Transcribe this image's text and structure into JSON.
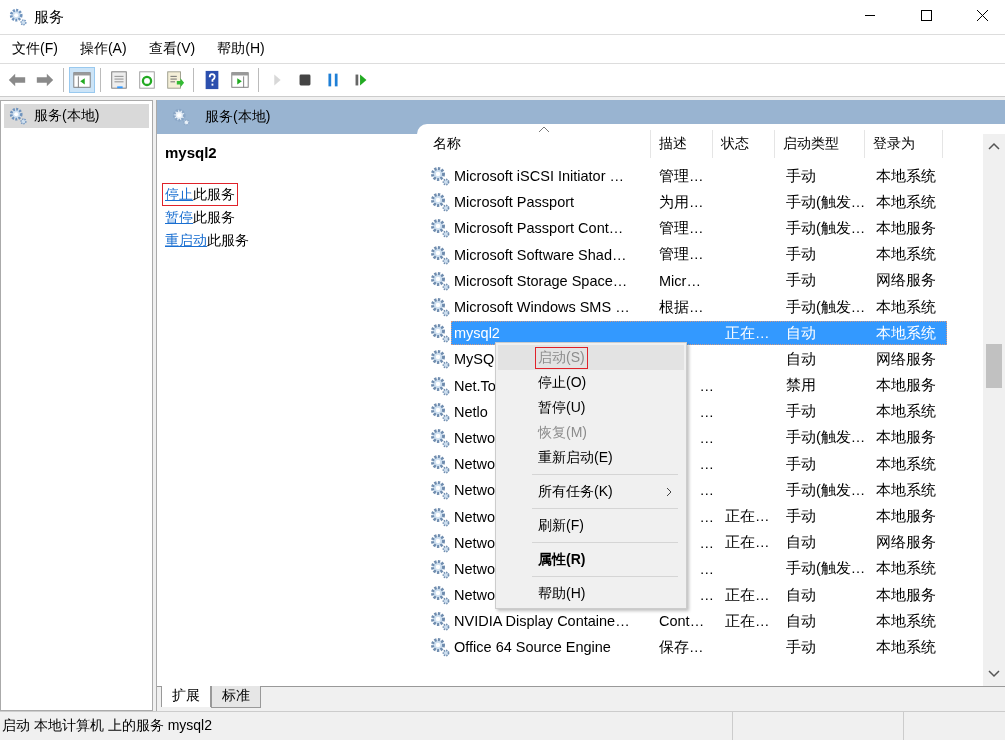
{
  "window": {
    "title": "服务"
  },
  "menu_bar": [
    "文件(F)",
    "操作(A)",
    "查看(V)",
    "帮助(H)"
  ],
  "toolbar": [
    {
      "kind": "back",
      "selected": false,
      "disabled": false
    },
    {
      "kind": "forward",
      "selected": false,
      "disabled": false
    },
    {
      "kind": "separator"
    },
    {
      "kind": "tree",
      "selected": true,
      "disabled": false
    },
    {
      "kind": "separator"
    },
    {
      "kind": "properties",
      "selected": false,
      "disabled": false
    },
    {
      "kind": "refresh",
      "selected": false,
      "disabled": false
    },
    {
      "kind": "export",
      "selected": false,
      "disabled": false
    },
    {
      "kind": "separator"
    },
    {
      "kind": "help",
      "selected": false,
      "disabled": false
    },
    {
      "kind": "actionpane",
      "selected": false,
      "disabled": false
    },
    {
      "kind": "separator"
    },
    {
      "kind": "play",
      "selected": false,
      "disabled": true
    },
    {
      "kind": "stop",
      "selected": false,
      "disabled": false
    },
    {
      "kind": "pause",
      "selected": false,
      "disabled": false
    },
    {
      "kind": "resume",
      "selected": false,
      "disabled": false
    }
  ],
  "tree": [
    {
      "label": "服务(本地)",
      "selected": true
    }
  ],
  "panel": {
    "title": "服务(本地)",
    "service_name": "mysql2",
    "actions": [
      {
        "link": "停止",
        "text": "此服务",
        "annotated": true
      },
      {
        "link": "暂停",
        "text": "此服务",
        "annotated": false
      },
      {
        "link": "重启动",
        "text": "此服务",
        "annotated": false
      }
    ]
  },
  "table": {
    "columns": [
      {
        "label": "名称",
        "sorted": true
      },
      {
        "label": "描述",
        "sorted": false
      },
      {
        "label": "状态",
        "sorted": false
      },
      {
        "label": "启动类型",
        "sorted": false
      },
      {
        "label": "登录为",
        "sorted": false
      }
    ],
    "rows": [
      {
        "name": "Microsoft iSCSI Initiator …",
        "desc": "管理…",
        "status": "",
        "startup": "手动",
        "logon": "本地系统",
        "selected": false
      },
      {
        "name": "Microsoft Passport",
        "desc": "为用…",
        "status": "",
        "startup": "手动(触发…",
        "logon": "本地系统",
        "selected": false
      },
      {
        "name": "Microsoft Passport Cont…",
        "desc": "管理…",
        "status": "",
        "startup": "手动(触发…",
        "logon": "本地服务",
        "selected": false
      },
      {
        "name": "Microsoft Software Shad…",
        "desc": "管理…",
        "status": "",
        "startup": "手动",
        "logon": "本地系统",
        "selected": false
      },
      {
        "name": "Microsoft Storage Space…",
        "desc": "Micr…",
        "status": "",
        "startup": "手动",
        "logon": "网络服务",
        "selected": false
      },
      {
        "name": "Microsoft Windows SMS …",
        "desc": "根据…",
        "status": "",
        "startup": "手动(触发…",
        "logon": "本地系统",
        "selected": false
      },
      {
        "name": "mysql2",
        "desc": "",
        "status": "正在…",
        "startup": "自动",
        "logon": "本地系统",
        "selected": true
      },
      {
        "name": "MySQ",
        "desc": "",
        "status": "",
        "startup": "自动",
        "logon": "网络服务",
        "selected": false
      },
      {
        "name": "Net.To",
        "desc": "…",
        "status": "",
        "startup": "禁用",
        "logon": "本地服务",
        "selected": false
      },
      {
        "name": "Netlo",
        "desc": "…",
        "status": "",
        "startup": "手动",
        "logon": "本地系统",
        "selected": false
      },
      {
        "name": "Netwo",
        "desc": "…",
        "status": "",
        "startup": "手动(触发…",
        "logon": "本地服务",
        "selected": false
      },
      {
        "name": "Netwo",
        "desc": "…",
        "status": "",
        "startup": "手动",
        "logon": "本地系统",
        "selected": false
      },
      {
        "name": "Netwo",
        "desc": "…",
        "status": "",
        "startup": "手动(触发…",
        "logon": "本地系统",
        "selected": false
      },
      {
        "name": "Netwo",
        "desc": "…",
        "status": "正在…",
        "startup": "手动",
        "logon": "本地服务",
        "selected": false
      },
      {
        "name": "Netwo",
        "desc": "…",
        "status": "正在…",
        "startup": "自动",
        "logon": "网络服务",
        "selected": false
      },
      {
        "name": "Netwo",
        "desc": "…",
        "status": "",
        "startup": "手动(触发…",
        "logon": "本地系统",
        "selected": false
      },
      {
        "name": "Netwo",
        "desc": "…",
        "status": "正在…",
        "startup": "自动",
        "logon": "本地服务",
        "selected": false
      },
      {
        "name": "NVIDIA Display Containe…",
        "desc": "Cont…",
        "status": "正在…",
        "startup": "自动",
        "logon": "本地系统",
        "selected": false
      },
      {
        "name": "Office 64 Source Engine",
        "desc": "保存…",
        "status": "",
        "startup": "手动",
        "logon": "本地系统",
        "selected": false
      }
    ]
  },
  "context_menu": [
    {
      "kind": "item",
      "label": "启动(S)",
      "disabled": true,
      "highlighted": true,
      "annotated": true,
      "bold": false,
      "submenu": false
    },
    {
      "kind": "item",
      "label": "停止(O)",
      "disabled": false,
      "highlighted": false,
      "annotated": false,
      "bold": false,
      "submenu": false
    },
    {
      "kind": "item",
      "label": "暂停(U)",
      "disabled": false,
      "highlighted": false,
      "annotated": false,
      "bold": false,
      "submenu": false
    },
    {
      "kind": "item",
      "label": "恢复(M)",
      "disabled": true,
      "highlighted": false,
      "annotated": false,
      "bold": false,
      "submenu": false
    },
    {
      "kind": "item",
      "label": "重新启动(E)",
      "disabled": false,
      "highlighted": false,
      "annotated": false,
      "bold": false,
      "submenu": false
    },
    {
      "kind": "separator"
    },
    {
      "kind": "item",
      "label": "所有任务(K)",
      "disabled": false,
      "highlighted": false,
      "annotated": false,
      "bold": false,
      "submenu": true
    },
    {
      "kind": "separator"
    },
    {
      "kind": "item",
      "label": "刷新(F)",
      "disabled": false,
      "highlighted": false,
      "annotated": false,
      "bold": false,
      "submenu": false
    },
    {
      "kind": "separator"
    },
    {
      "kind": "item",
      "label": "属性(R)",
      "disabled": false,
      "highlighted": false,
      "annotated": false,
      "bold": true,
      "submenu": false
    },
    {
      "kind": "separator"
    },
    {
      "kind": "item",
      "label": "帮助(H)",
      "disabled": false,
      "highlighted": false,
      "annotated": false,
      "bold": false,
      "submenu": false
    }
  ],
  "tabs": [
    {
      "label": "扩展",
      "selected": true
    },
    {
      "label": "标准",
      "selected": false
    }
  ],
  "status_bar": {
    "text": "启动 本地计算机 上的服务 mysql2"
  }
}
